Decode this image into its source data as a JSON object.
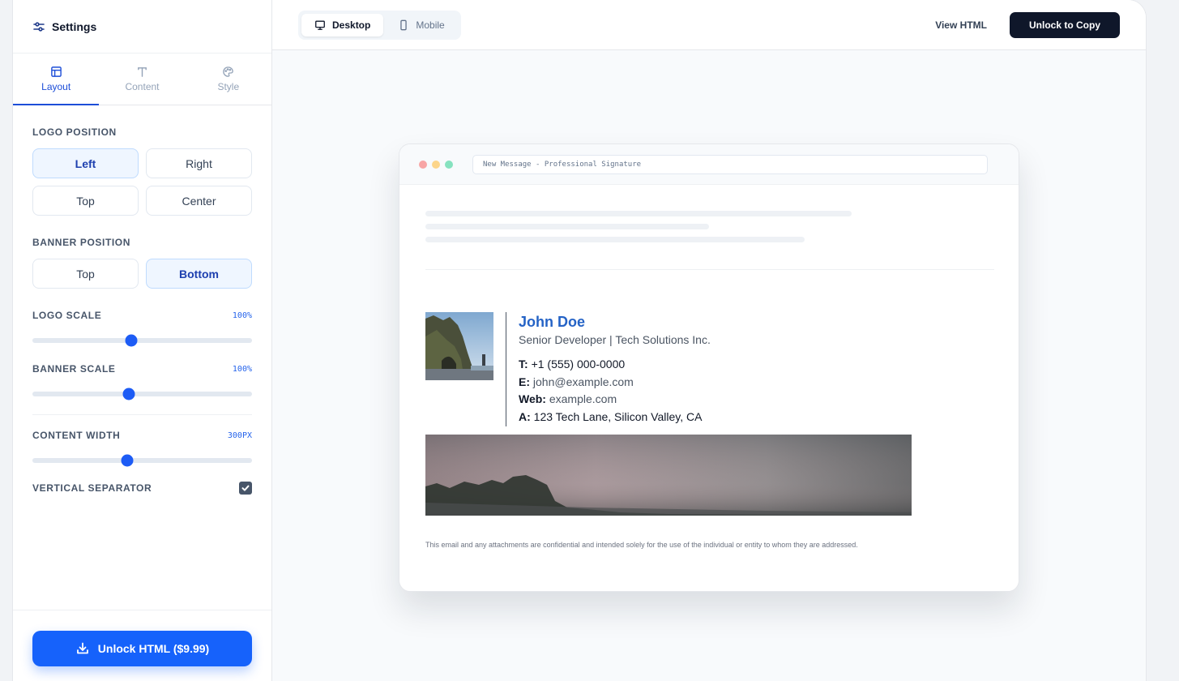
{
  "sidebar": {
    "title": "Settings",
    "tabs": [
      {
        "label": "Layout",
        "icon": "layout-icon",
        "active": true
      },
      {
        "label": "Content",
        "icon": "text-icon",
        "active": false
      },
      {
        "label": "Style",
        "icon": "palette-icon",
        "active": false
      }
    ],
    "logo_position": {
      "label": "LOGO POSITION",
      "options": [
        "Left",
        "Right",
        "Top",
        "Center"
      ],
      "selected": "Left"
    },
    "banner_position": {
      "label": "BANNER POSITION",
      "options": [
        "Top",
        "Bottom"
      ],
      "selected": "Bottom"
    },
    "logo_scale": {
      "label": "LOGO SCALE",
      "value_text": "100%",
      "fraction": 0.45
    },
    "banner_scale": {
      "label": "BANNER SCALE",
      "value_text": "100%",
      "fraction": 0.44
    },
    "content_width": {
      "label": "CONTENT WIDTH",
      "value_text": "300px",
      "fraction": 0.43
    },
    "vertical_separator": {
      "label": "VERTICAL SEPARATOR",
      "checked": true
    },
    "unlock_button": "Unlock HTML ($9.99)"
  },
  "topbar": {
    "view_modes": [
      {
        "label": "Desktop",
        "icon": "monitor-icon",
        "active": true
      },
      {
        "label": "Mobile",
        "icon": "phone-icon",
        "active": false
      }
    ],
    "view_html": "View HTML",
    "unlock_copy": "Unlock to Copy"
  },
  "preview": {
    "window_title": "New Message - Professional Signature",
    "signature": {
      "name": "John Doe",
      "role": "Senior Developer | Tech Solutions Inc.",
      "phone_label": "T:",
      "phone": "+1 (555) 000-0000",
      "email_label": "E:",
      "email": "john@example.com",
      "web_label": "Web:",
      "web": "example.com",
      "address_label": "A:",
      "address": "123 Tech Lane, Silicon Valley, CA"
    },
    "disclaimer": "This email and any attachments are confidential and intended solely for the use of the individual or entity to whom they are addressed."
  },
  "colors": {
    "accent": "#1662fb",
    "name_blue": "#2563c6",
    "dark_button": "#0f172a"
  }
}
